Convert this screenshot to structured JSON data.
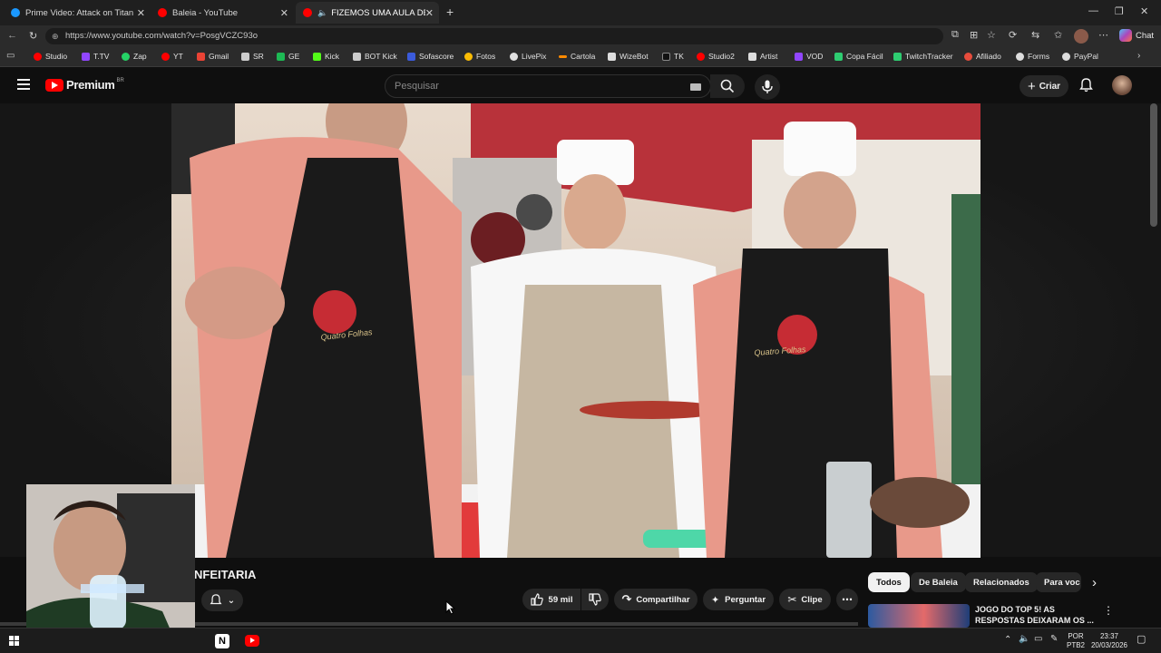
{
  "browser": {
    "tabs": [
      {
        "title": "Prime Video: Attack on Titan",
        "active": false,
        "icon": "prime-video-icon",
        "color": "#1a98ff"
      },
      {
        "title": "Baleia - YouTube",
        "active": false,
        "icon": "youtube-icon",
        "color": "#ff0000"
      },
      {
        "title": "FIZEMOS UMA AULA DE CON",
        "active": true,
        "icon": "youtube-icon",
        "color": "#ff0000"
      }
    ],
    "new_tab": "+",
    "url": "https://www.youtube.com/watch?v=PosgVCZC93o",
    "chat_label": "Chat",
    "bookmarks": [
      {
        "label": "Studio",
        "color": "#ff0000"
      },
      {
        "label": "T.TV",
        "color": "#9146ff"
      },
      {
        "label": "Zap",
        "color": "#25d366"
      },
      {
        "label": "YT",
        "color": "#ff0000"
      },
      {
        "label": "Gmail",
        "color": "#ea4335"
      },
      {
        "label": "SR",
        "color": "#cccccc"
      },
      {
        "label": "GE",
        "color": "#1db954"
      },
      {
        "label": "Kick",
        "color": "#53fc18"
      },
      {
        "label": "BOT Kick",
        "color": "#cccccc"
      },
      {
        "label": "Sofascore",
        "color": "#3b5bdb"
      },
      {
        "label": "Fotos",
        "color": "#fbbc04"
      },
      {
        "label": "LivePix",
        "color": "#e0e0e0"
      },
      {
        "label": "Cartola",
        "color": "#ff8a00"
      },
      {
        "label": "WizeBot",
        "color": "#dddddd"
      },
      {
        "label": "TK",
        "color": "#111111"
      },
      {
        "label": "Studio2",
        "color": "#ff0000"
      },
      {
        "label": "Artist",
        "color": "#dddddd"
      },
      {
        "label": "VOD",
        "color": "#9146ff"
      },
      {
        "label": "Copa Fácil",
        "color": "#2ecc71"
      },
      {
        "label": "TwitchTracker",
        "color": "#2ecc71"
      },
      {
        "label": "Afiliado",
        "color": "#e74c3c"
      },
      {
        "label": "Forms",
        "color": "#dddddd"
      },
      {
        "label": "PayPal",
        "color": "#dddddd"
      }
    ]
  },
  "youtube": {
    "logo_text": "Premium",
    "region": "BR",
    "search_placeholder": "Pesquisar",
    "create_label": "Criar",
    "video_title": "NFEITARIA",
    "like_count": "59 mil",
    "share_label": "Compartilhar",
    "ask_label": "Perguntar",
    "clip_label": "Clipe",
    "chips": [
      "Todos",
      "De Baleia",
      "Relacionados",
      "Para voc"
    ],
    "suggested_title_1": "JOGO DO TOP 5! AS",
    "suggested_title_2": "RESPOSTAS DEIXARAM OS ...",
    "apron_brand": "Quatro Folhas",
    "accent": "#ff0000"
  },
  "taskbar": {
    "lang_1": "POR",
    "lang_2": "PTB2",
    "time": "23:37",
    "date": "20/03/2026"
  }
}
